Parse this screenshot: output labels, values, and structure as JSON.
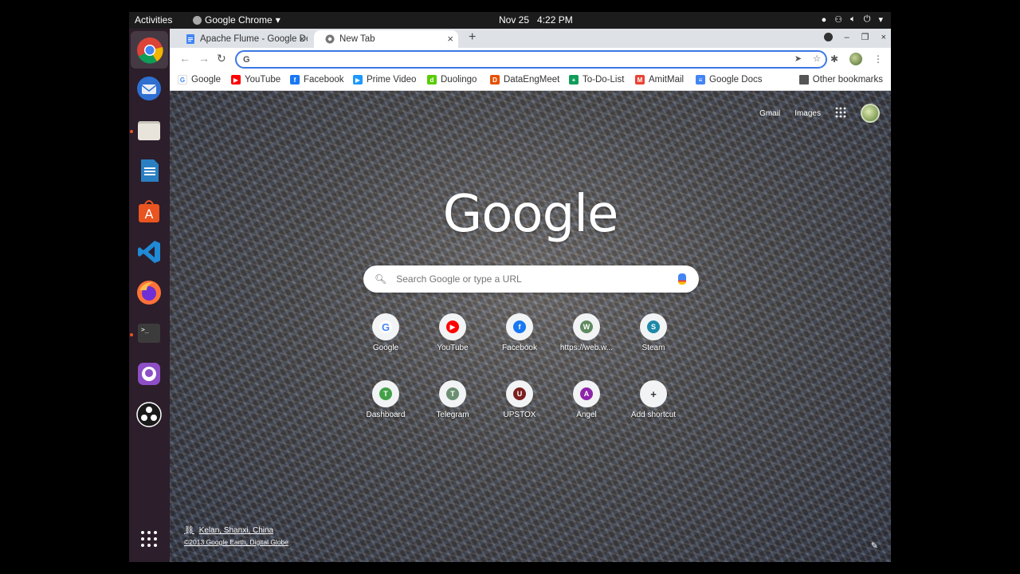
{
  "topbar": {
    "activities": "Activities",
    "app_name": "Google Chrome",
    "app_menu_arrow": "▾",
    "date": "Nov 25",
    "time": "4:22 PM",
    "tray_arrow": "▾"
  },
  "dock": {
    "items": [
      "chrome",
      "thunderbird",
      "files",
      "libreoffice-writer",
      "software-center",
      "vscode",
      "firefox",
      "terminal",
      "github-desktop",
      "obs-studio",
      "show-applications"
    ]
  },
  "tabs": [
    {
      "title": "Apache Flume - Google Do",
      "close": "×"
    },
    {
      "title": "New Tab",
      "close": "×"
    }
  ],
  "new_tab_symbol": "+",
  "window_controls": {
    "minimize": "–",
    "maximize": "❐",
    "close": "×"
  },
  "omnibox": {
    "value": "",
    "g_letter": "G"
  },
  "bookmarks": [
    {
      "label": "Google",
      "icon": "G",
      "color": "#ffffff"
    },
    {
      "label": "YouTube",
      "icon": "▶",
      "color": "#ff0000"
    },
    {
      "label": "Facebook",
      "icon": "f",
      "color": "#1877f2"
    },
    {
      "label": "Prime Video",
      "icon": "▶",
      "color": "#1a98ff"
    },
    {
      "label": "Duolingo",
      "icon": "d",
      "color": "#58cc02"
    },
    {
      "label": "DataEngMeet",
      "icon": "D",
      "color": "#e65100"
    },
    {
      "label": "To-Do-List",
      "icon": "+",
      "color": "#0f9d58"
    },
    {
      "label": "AmitMail",
      "icon": "M",
      "color": "#ea4335"
    },
    {
      "label": "Google Docs",
      "icon": "≡",
      "color": "#4285f4"
    }
  ],
  "other_bookmarks": "Other bookmarks",
  "ntp": {
    "gmail": "Gmail",
    "images": "Images",
    "apps_glyph": "⋮⋮⋮",
    "logo": "Google",
    "search_placeholder": "Search Google or type a URL",
    "shortcuts": [
      {
        "label": "Google",
        "letter": "G",
        "color": "#ffffff",
        "text_color": "#4285f4"
      },
      {
        "label": "YouTube",
        "letter": "▶",
        "color": "#ff0000",
        "text_color": "#ffffff"
      },
      {
        "label": "Facebook",
        "letter": "f",
        "color": "#1877f2",
        "text_color": "#ffffff"
      },
      {
        "label": "https://web.w...",
        "letter": "W",
        "color": "#5f8a5f",
        "text_color": "#ffffff"
      },
      {
        "label": "Steam",
        "letter": "S",
        "color": "#1e88a8",
        "text_color": "#ffffff"
      },
      {
        "label": "Dashboard",
        "letter": "T",
        "color": "#43a047",
        "text_color": "#ffffff"
      },
      {
        "label": "Telegram",
        "letter": "T",
        "color": "#6b8f71",
        "text_color": "#ffffff"
      },
      {
        "label": "UPSTOX",
        "letter": "U",
        "color": "#7b1f1f",
        "text_color": "#ffffff"
      },
      {
        "label": "Angel",
        "letter": "A",
        "color": "#8e24aa",
        "text_color": "#ffffff"
      },
      {
        "label": "Add shortcut",
        "letter": "+",
        "color": "#f1f3f4",
        "text_color": "#333333"
      }
    ],
    "location": "Kelan, Shanxi, China",
    "copyright": "©2013 Google Earth, Digital Globe",
    "customize_glyph": "✎"
  }
}
